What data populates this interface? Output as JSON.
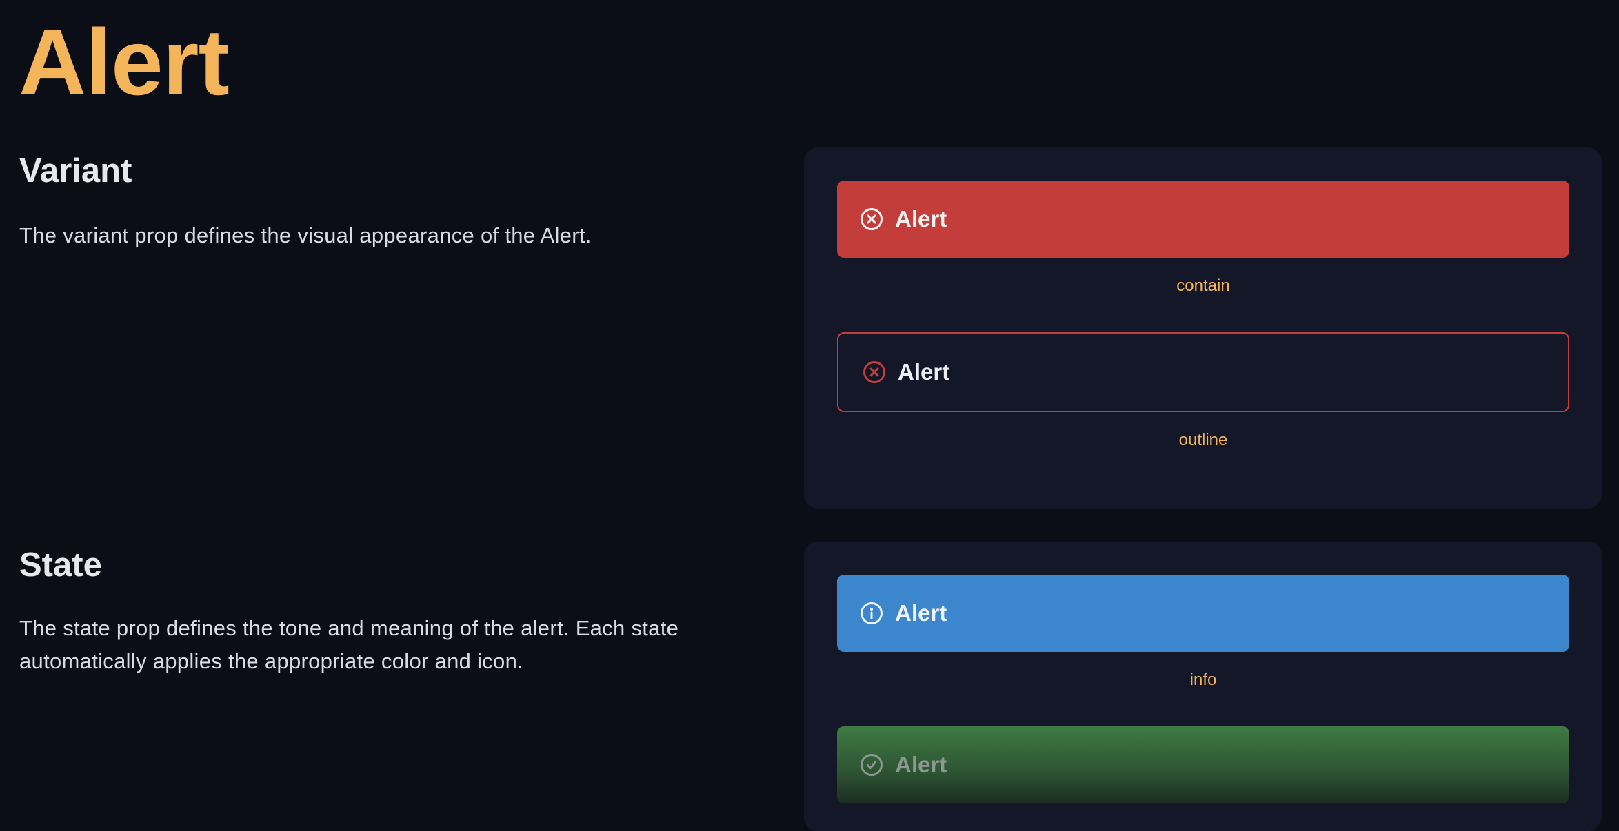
{
  "page": {
    "title": "Alert"
  },
  "sections": {
    "variant": {
      "heading": "Variant",
      "description": "The variant prop defines the visual appearance of the Alert.",
      "examples": [
        {
          "alert_text": "Alert",
          "caption": "contain",
          "icon": "x-circle-icon"
        },
        {
          "alert_text": "Alert",
          "caption": "outline",
          "icon": "x-circle-icon"
        }
      ]
    },
    "state": {
      "heading": "State",
      "description_line1": "The state prop defines the tone and meaning of the alert. Each state",
      "description_line2": "automatically applies the appropriate color and icon.",
      "examples": [
        {
          "alert_text": "Alert",
          "caption": "info",
          "icon": "info-circle-icon"
        },
        {
          "alert_text": "Alert",
          "icon": "check-circle-icon"
        }
      ]
    }
  },
  "colors": {
    "background": "#0b0d17",
    "panel": "#141727",
    "accent": "#f4b45a",
    "error": "#c33e3b",
    "info": "#3b86cc",
    "success": "#3f7a44"
  }
}
